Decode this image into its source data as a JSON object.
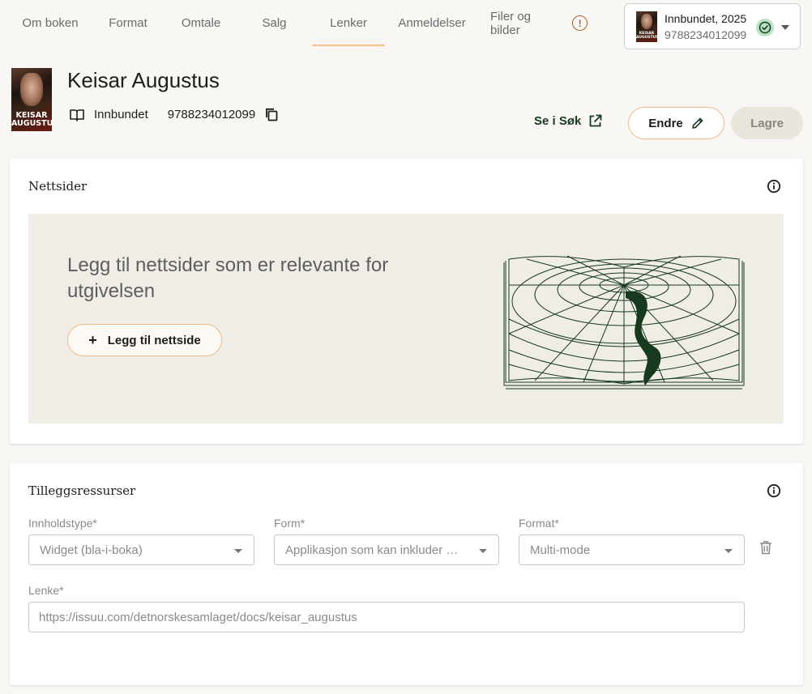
{
  "tabs": [
    {
      "label": "Om boken"
    },
    {
      "label": "Format"
    },
    {
      "label": "Omtale"
    },
    {
      "label": "Salg"
    },
    {
      "label": "Lenker",
      "active": true
    },
    {
      "label": "Anmeldelser"
    },
    {
      "label": "Filer og bilder",
      "warning": "!"
    }
  ],
  "edition": {
    "title": "Innbundet, 2025",
    "isbn": "9788234012099",
    "status_icon": "check-circle-icon"
  },
  "book": {
    "cover_text": "KEISAR AUGUSTUS",
    "title": "Keisar Augustus",
    "format": "Innbundet",
    "isbn": "9788234012099"
  },
  "actions": {
    "see_search": "Se i Søk",
    "edit": "Endre",
    "save": "Lagre"
  },
  "websites": {
    "title": "Nettsider",
    "empty_text": "Legg til nettsider som er relevante for utgivelsen",
    "add_button": "Legg til nettside"
  },
  "resources": {
    "title": "Tilleggsressurser",
    "content_type_label": "Innholdstype*",
    "content_type_value": "Widget (bla-i-boka)",
    "form_label": "Form*",
    "form_value": "Applikasjon som kan inkluder …",
    "format_label": "Format*",
    "format_value": "Multi-mode",
    "link_label": "Lenke*",
    "link_value": "https://issuu.com/detnorskesamlaget/docs/keisar_augustus"
  },
  "colors": {
    "accent": "#f4c18d",
    "dark_green": "#173a1e",
    "panel_bg": "#efede6",
    "page_bg": "#f8f7f4"
  }
}
